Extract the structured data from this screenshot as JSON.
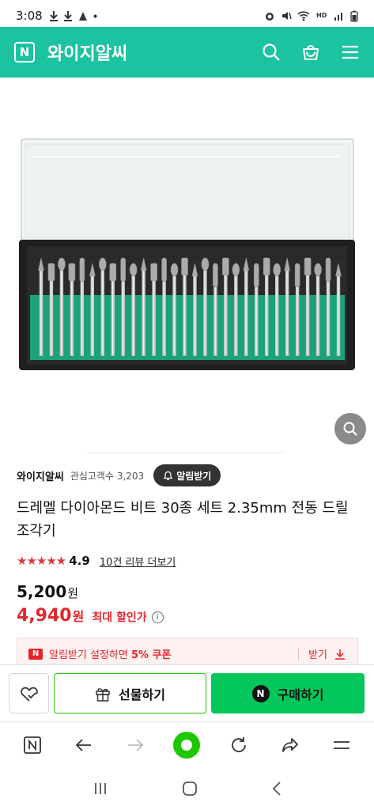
{
  "status_bar": {
    "time": "3:08"
  },
  "header": {
    "store_name": "와이지알씨",
    "logo_letter": "N"
  },
  "seller": {
    "name": "와이지알씨",
    "fans": "관심고객수 3,203",
    "alarm_button": "알림받기"
  },
  "product": {
    "title": "드레멜 다이아몬드 비트 30종 세트 2.35mm 전동 드릴 조각기",
    "rating": "4.9",
    "review_link": "10건 리뷰 더보기",
    "price": "5,200",
    "price_unit": "원",
    "sale_price": "4,940",
    "sale_unit": "원",
    "sale_label": "최대 할인가",
    "bit_count": 30
  },
  "coupon": {
    "n_letter": "N",
    "text_prefix": "알림받기 설정하면 ",
    "text_bold": "5% 쿠폰",
    "receive": "받기"
  },
  "buy_bar": {
    "gift_label": "선물하기",
    "buy_label": "구매하기",
    "buy_letter": "N"
  },
  "colors": {
    "brand": "#1bc3a0",
    "buy_green": "#03c75a",
    "sale_red": "#e5262c"
  }
}
